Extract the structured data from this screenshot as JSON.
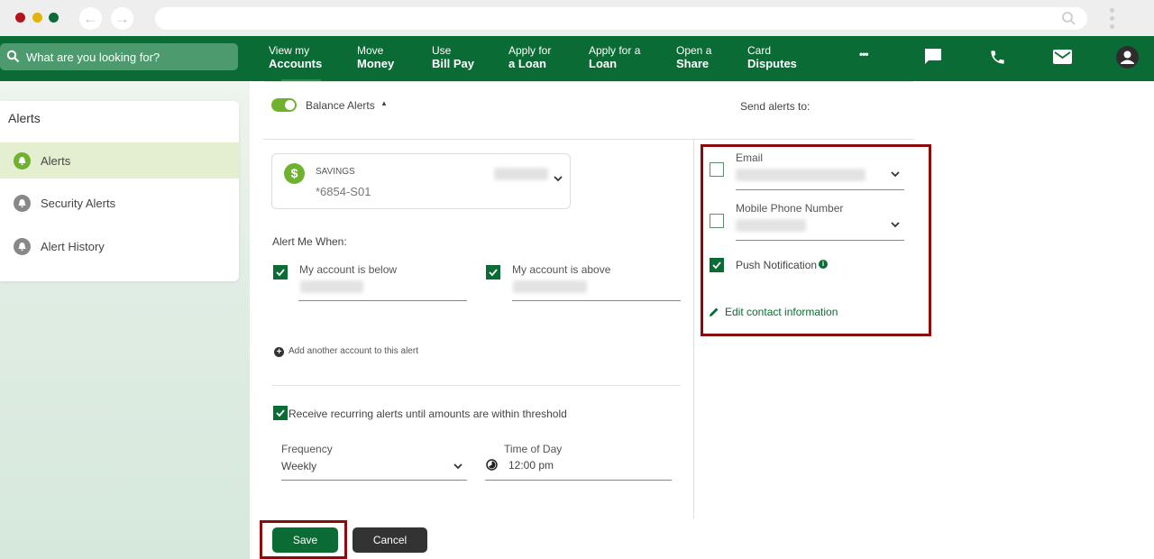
{
  "browser": {
    "back_icon": "←",
    "forward_icon": "→",
    "url": ""
  },
  "topnav": {
    "search_placeholder": "What are you looking for?",
    "items": [
      {
        "line1": "View my",
        "line2": "Accounts"
      },
      {
        "line1": "Move",
        "line2": "Money"
      },
      {
        "line1": "Use",
        "line2": "Bill Pay"
      },
      {
        "line1": "Apply for",
        "line2": "a Loan"
      },
      {
        "line1": "Apply for a",
        "line2": "Loan"
      },
      {
        "line1": "Open a",
        "line2": "Share"
      },
      {
        "line1": "Card",
        "line2": "Disputes"
      }
    ],
    "more_icon": "•••",
    "icons": [
      "more-icon",
      "chat-icon",
      "phone-icon",
      "mail-icon",
      "profile-icon"
    ]
  },
  "sidebar": {
    "title": "Alerts",
    "items": [
      {
        "label": "Alerts",
        "active": true
      },
      {
        "label": "Security Alerts",
        "active": false
      },
      {
        "label": "Alert History",
        "active": false
      }
    ]
  },
  "balance_alerts": {
    "toggle_label": "Balance Alerts",
    "toggle_on": true,
    "caret": "▲",
    "account": {
      "type": "SAVINGS",
      "number": "*6854-S01",
      "icon": "$"
    },
    "alert_me_when": "Alert Me When:",
    "below": {
      "label": "My account is below",
      "checked": true
    },
    "above": {
      "label": "My account is above",
      "checked": true
    },
    "add_account": "Add another account to this alert",
    "add_icon": "+",
    "recurring": {
      "label": "Receive recurring alerts until amounts are within threshold",
      "checked": true
    },
    "frequency": {
      "label": "Frequency",
      "value": "Weekly"
    },
    "time_of_day": {
      "label": "Time of Day",
      "value": "12:00  pm"
    }
  },
  "send_alerts": {
    "title": "Send alerts to:",
    "email": {
      "label": "Email",
      "checked": false
    },
    "mobile": {
      "label": "Mobile Phone Number",
      "checked": false
    },
    "push": {
      "label": "Push Notification",
      "checked": true,
      "info_icon": "i"
    },
    "edit_contact": "Edit contact information"
  },
  "actions": {
    "save": "Save",
    "cancel": "Cancel"
  },
  "colors": {
    "brand_green": "#0b6b35",
    "accent_green": "#6fb22d",
    "highlight_red": "#8b0a0a"
  }
}
